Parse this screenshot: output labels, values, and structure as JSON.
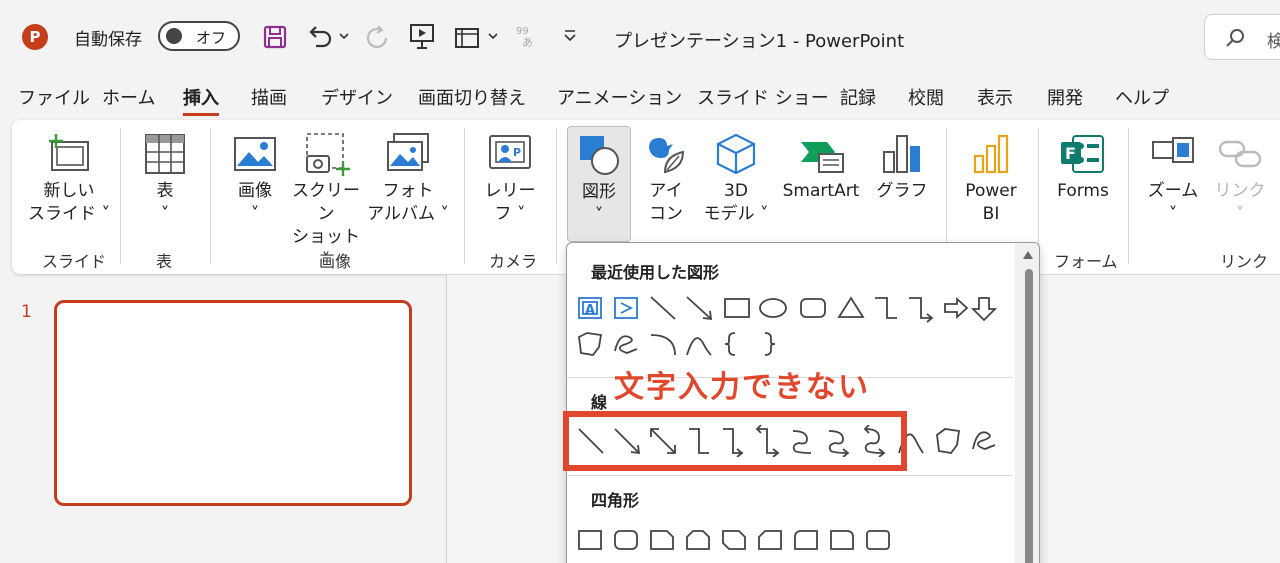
{
  "titlebar": {
    "app_logo": "P",
    "autosave_label": "自動保存",
    "autosave_state": "オフ",
    "doc_title": "プレゼンテーション1  -  PowerPoint",
    "search_placeholder": "検"
  },
  "tabs": [
    "ファイル",
    "ホーム",
    "挿入",
    "描画",
    "デザイン",
    "画面切り替え",
    "アニメーション",
    "スライド ショー",
    "記録",
    "校閲",
    "表示",
    "開発",
    "ヘルプ"
  ],
  "active_tab": "挿入",
  "ribbon": {
    "new_slide": "新しい\nスライド ˅",
    "table": "表\n˅",
    "image": "画像\n˅",
    "screenshot": "スクリーン\nショット ˅",
    "photo_album": "フォト\nアルバム ˅",
    "cameo": "レリー\nフ ˅",
    "shapes": "図形\n˅",
    "icons": "アイ\nコン",
    "model3d": "3D\nモデル ˅",
    "smartart": "SmartArt",
    "chart": "グラフ",
    "powerbi": "Power\nBI",
    "forms": "Forms",
    "zoom": "ズーム\n˅",
    "link": "リンク\n˅",
    "groups": {
      "slides": "スライド",
      "tables": "表",
      "images": "画像",
      "camera": "カメラ",
      "forms": "フォーム",
      "links": "リンク"
    }
  },
  "slides_pane": {
    "slide_number": "1"
  },
  "shapes_panel": {
    "recent_title": "最近使用した図形",
    "lines_title": "線",
    "rect_title": "四角形",
    "text_box_glyph": "A"
  },
  "annotation": "文字入力できない",
  "colors": {
    "accent": "#c43e1c",
    "annotation": "#e0472c",
    "icon_blue": "#2b7cd3",
    "icon_teal": "#0f7b6c"
  }
}
